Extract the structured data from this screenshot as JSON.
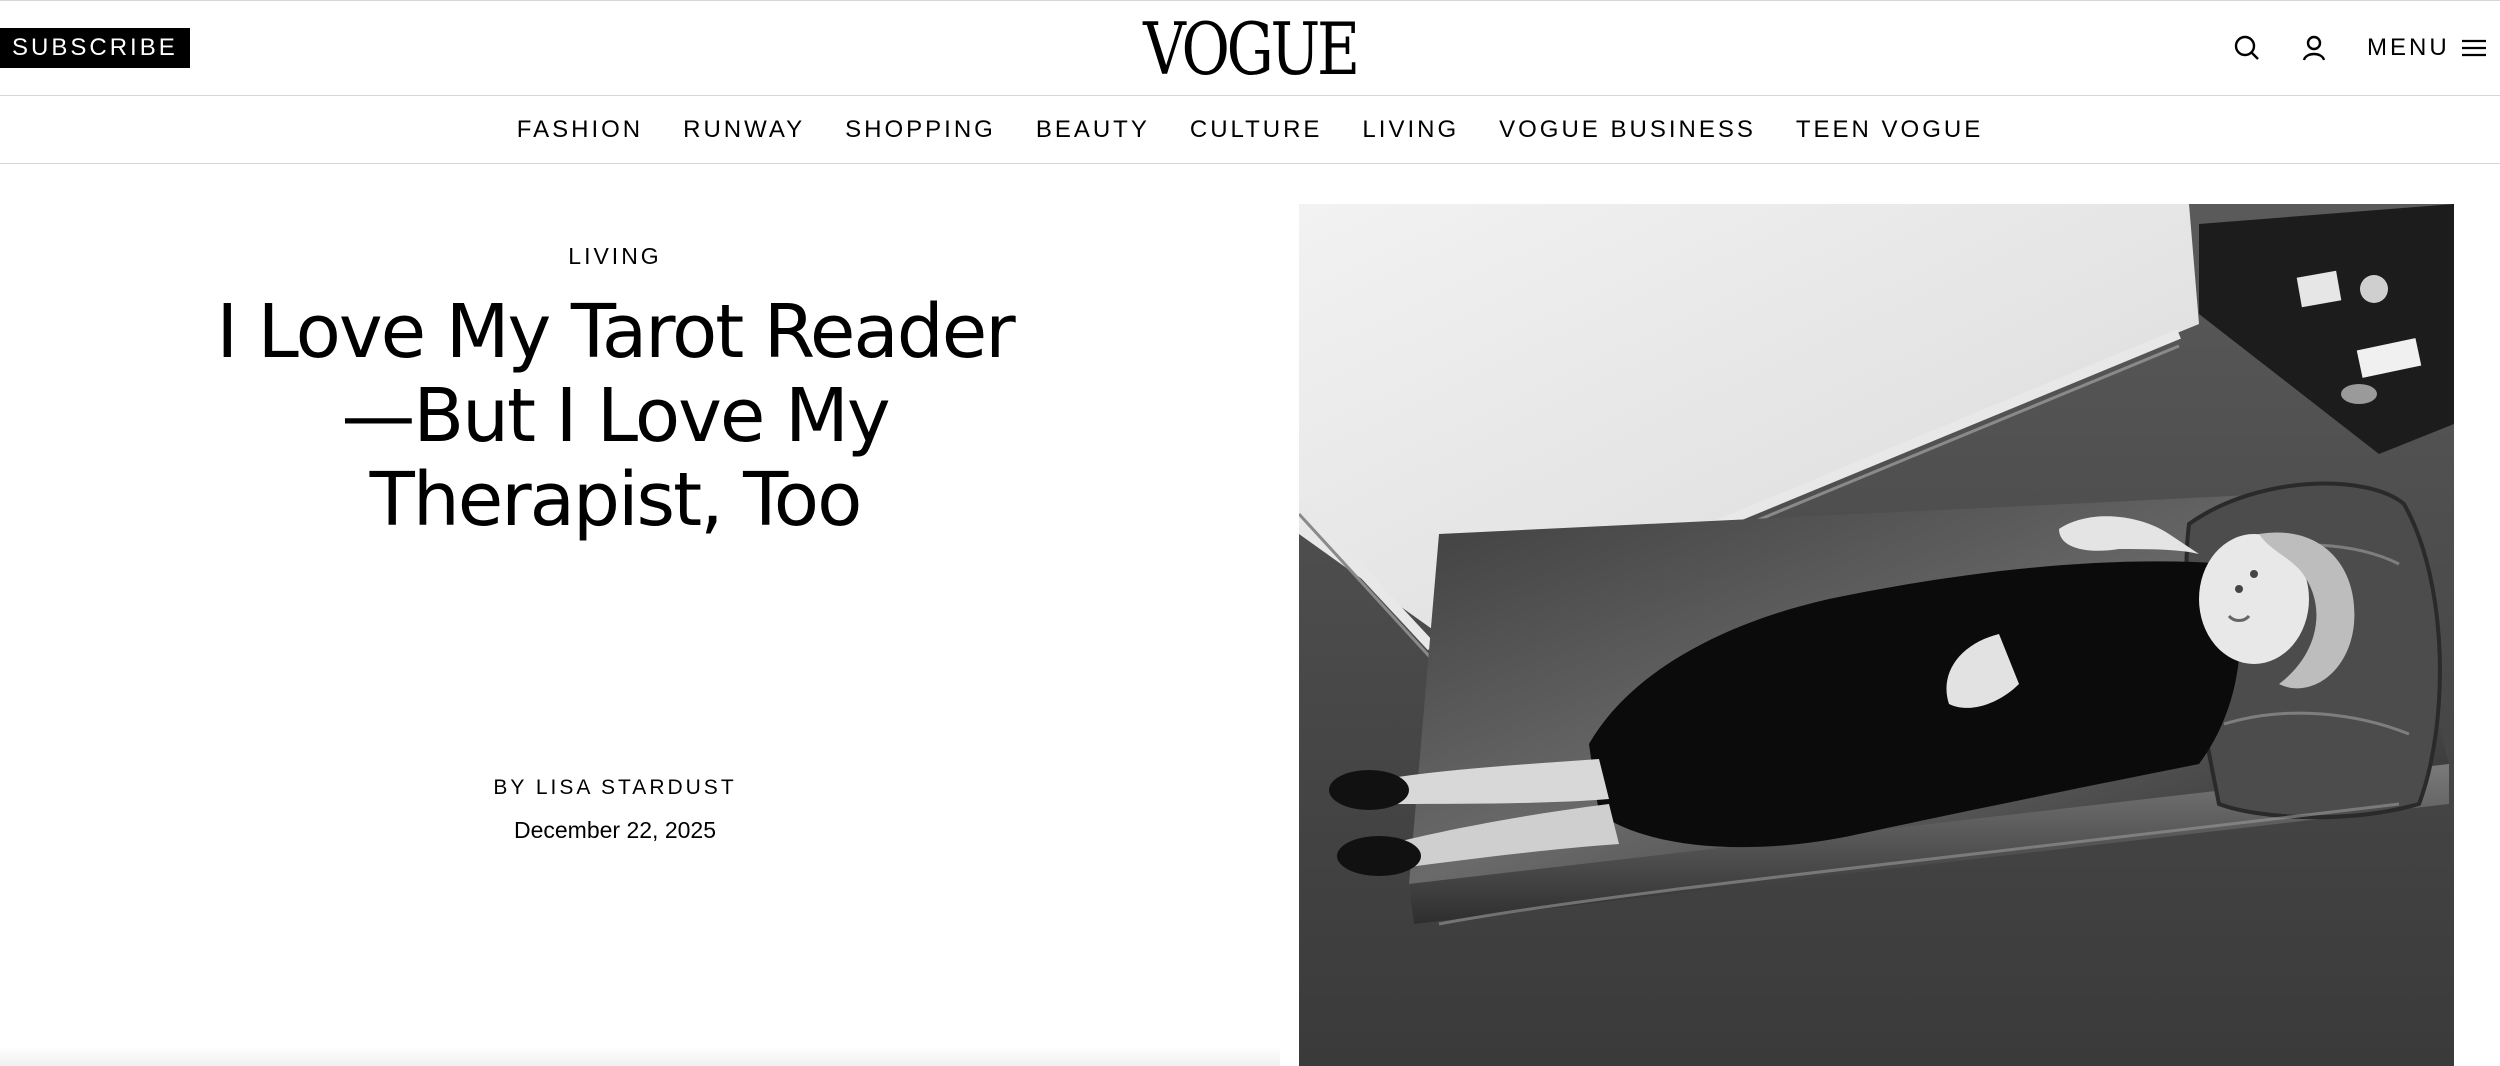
{
  "header": {
    "subscribe_label": "SUBSCRIBE",
    "logo_text": "VOGUE",
    "menu_label": "MENU",
    "icons": [
      "search-icon",
      "account-icon",
      "hamburger-icon"
    ]
  },
  "nav": {
    "items": [
      {
        "label": "FASHION"
      },
      {
        "label": "RUNWAY"
      },
      {
        "label": "SHOPPING"
      },
      {
        "label": "BEAUTY"
      },
      {
        "label": "CULTURE"
      },
      {
        "label": "LIVING"
      },
      {
        "label": "VOGUE BUSINESS"
      },
      {
        "label": "TEEN VOGUE"
      }
    ]
  },
  "article": {
    "section": "LIVING",
    "headline_lines": [
      "I Love My Tarot Reader",
      "—But I Love My",
      "Therapist, Too"
    ],
    "byline_prefix": "BY",
    "author": "LISA STARDUST",
    "date": "December 22, 2025"
  },
  "colors": {
    "brand": "#000000",
    "background": "#ffffff",
    "divider": "#d6d6d6"
  }
}
